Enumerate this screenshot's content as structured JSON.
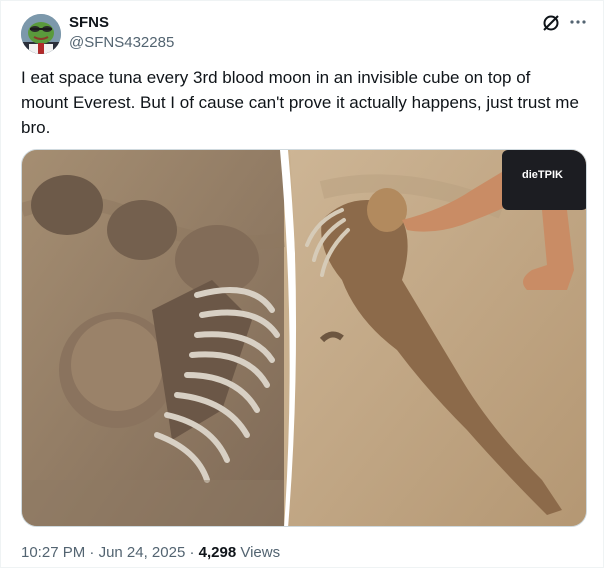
{
  "author": {
    "name": "SFNS",
    "handle": "@SFNS432285"
  },
  "tweet": {
    "text": "I eat space tuna every 3rd blood moon in an invisible cube on top of mount Everest. But I of cause can't prove it actually happens, just trust me bro."
  },
  "meta": {
    "time": "10:27 PM",
    "separator1": " · ",
    "date": "Jun 24, 2025",
    "separator2": " · ",
    "views_count": "4,298",
    "views_label": " Views"
  },
  "icons": {
    "grok": "grok-icon",
    "more": "more-icon"
  },
  "colors": {
    "text": "#0f1419",
    "secondary": "#536471",
    "sand": "#c9b08e"
  },
  "media": {
    "shirt_text": "dieTPIK"
  }
}
